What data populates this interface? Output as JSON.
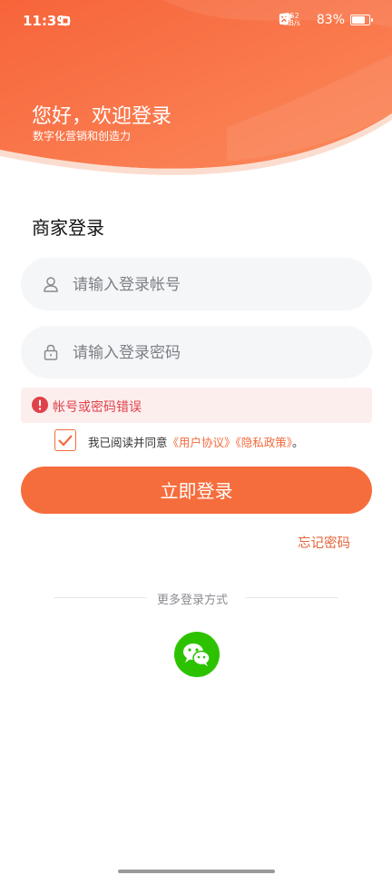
{
  "status_bar": {
    "time": "11:39",
    "network_speed_value": "352",
    "network_speed_unit": "KB/s",
    "battery": "83%"
  },
  "hero": {
    "title": "您好，欢迎登录",
    "subtitle": "数字化营销和创造力"
  },
  "login": {
    "section_title": "商家登录",
    "account_placeholder": "请输入登录帐号",
    "password_placeholder": "请输入登录密码",
    "error_message": "帐号或密码错误",
    "agree_prefix": "我已阅读并同意",
    "user_agreement": "《用户协议》",
    "privacy_policy": "《隐私政策》",
    "agree_suffix": "。",
    "agree_checked": true,
    "submit_label": "立即登录",
    "forgot_password": "忘记密码"
  },
  "alternatives": {
    "label": "更多登录方式",
    "methods": [
      {
        "name": "wechat",
        "icon": "wechat-icon"
      }
    ]
  },
  "colors": {
    "accent": "#f66d3d",
    "error": "#e0424a",
    "wechat": "#2dc200"
  }
}
